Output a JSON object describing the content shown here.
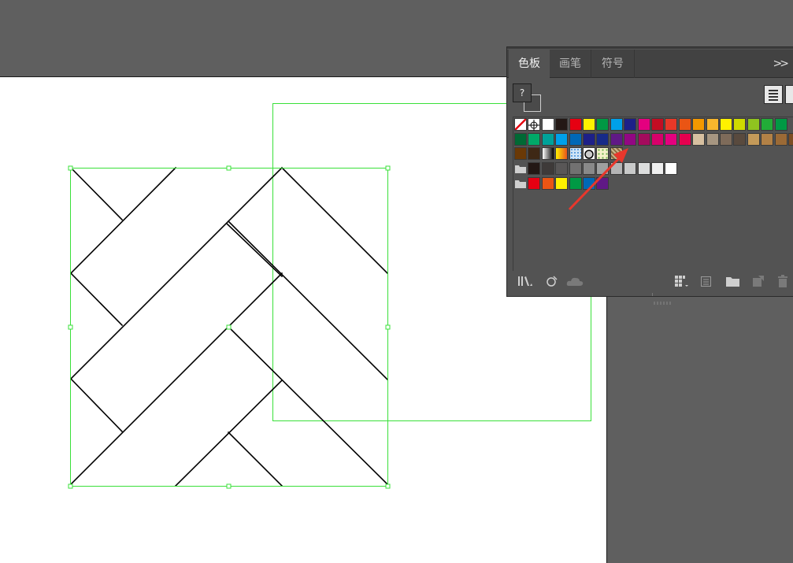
{
  "workspace": {
    "background": "#5f5f5f",
    "artboard_color": "#ffffff",
    "selection_color": "#39e039"
  },
  "swatches_panel": {
    "tabs": [
      {
        "label": "色板",
        "active": true
      },
      {
        "label": "画笔",
        "active": false
      },
      {
        "label": "符号",
        "active": false
      }
    ],
    "collapse_label": ">>",
    "fill_label": "?",
    "rows": [
      [
        "none",
        "registration",
        "#ffffff",
        "#231815",
        "#e60012",
        "#fff100",
        "#009944",
        "#00a0e9",
        "#1d2088",
        "#e4007f",
        "#c30d23",
        "#e83828",
        "#ea5514",
        "#f39800",
        "#f8b62d",
        "#fff100",
        "#cfdb00",
        "#8fc31f",
        "#22ac38",
        "#009944"
      ],
      [
        "#006934",
        "#00a968",
        "#00a29a",
        "#00a0e9",
        "#0068b7",
        "#1d2088",
        "#172a88",
        "#601986",
        "#920783",
        "#a40b5d",
        "#d7006a",
        "#e4007f",
        "#e5004f",
        "#d7c0a0",
        "#a69681",
        "#7e6b5a",
        "#594a3e",
        "#c49a59",
        "#b28146",
        "#9b6a36",
        "#7d4e24"
      ],
      [
        "#6a3906",
        "#3e2815",
        "gradient-bw",
        "gradient-orange",
        "pattern-dots",
        "pattern-circle",
        "pattern-leaf",
        "pattern-tile"
      ],
      [
        "folder",
        "#231815",
        "#3e3a39",
        "#595757",
        "#727171",
        "#898989",
        "#9fa0a0",
        "#b5b5b6",
        "#c9caca",
        "#dcdddd",
        "#efefef",
        "#ffffff"
      ],
      [
        "folder",
        "#e60012",
        "#ea5514",
        "#fff100",
        "#009944",
        "#0068b7",
        "#601986"
      ]
    ],
    "footer_icons": [
      "library-icon",
      "swatch-kind-icon",
      "cloud-icon",
      "swatch-options-icon",
      "new-color-group-icon",
      "new-swatch-icon",
      "delete-swatch-icon"
    ]
  },
  "annotation": {
    "color": "#e8372c"
  }
}
